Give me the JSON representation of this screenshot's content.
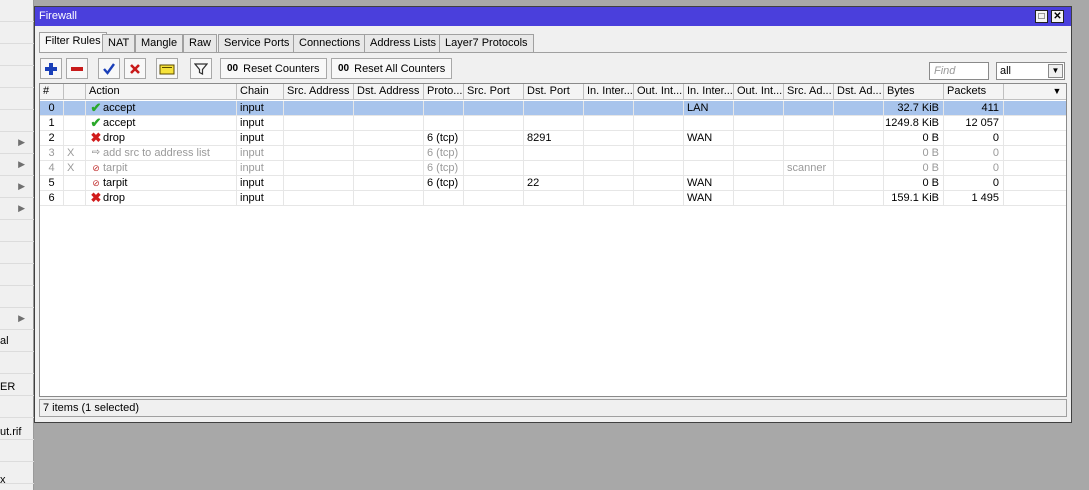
{
  "sidebar": {
    "labels": [
      "al",
      "ER",
      "ut.rif",
      "x"
    ]
  },
  "window": {
    "title": "Firewall",
    "restore_icon": "□",
    "close_icon": "✕"
  },
  "tabs": [
    {
      "label": "Filter Rules",
      "active": true
    },
    {
      "label": "NAT"
    },
    {
      "label": "Mangle"
    },
    {
      "label": "Raw"
    },
    {
      "label": "Service Ports"
    },
    {
      "label": "Connections"
    },
    {
      "label": "Address Lists"
    },
    {
      "label": "Layer7 Protocols"
    }
  ],
  "toolbar": {
    "add_icon": "plus-icon",
    "remove_icon": "minus-icon",
    "enable_icon": "check-icon",
    "disable_icon": "x-icon",
    "comment_icon": "comment-icon",
    "filter_icon": "filter-icon",
    "reset_counters": "Reset Counters",
    "reset_all_counters": "Reset All Counters",
    "counters_glyph": "00",
    "find_placeholder": "Find",
    "filter_select": "all"
  },
  "columns": [
    "#",
    "",
    "Action",
    "Chain",
    "Src. Address",
    "Dst. Address",
    "Proto...",
    "Src. Port",
    "Dst. Port",
    "In. Inter...",
    "Out. Int...",
    "In. Inter...",
    "Out. Int...",
    "Src. Ad...",
    "Dst. Ad...",
    "Bytes",
    "Packets"
  ],
  "rows": [
    {
      "num": "0",
      "flag": "",
      "action": "accept",
      "action_icon": "check",
      "chain": "input",
      "proto": "",
      "dst_port": "",
      "in_list": "LAN",
      "src_addr_list": "",
      "bytes": "32.7 KiB",
      "packets": "411",
      "selected": true,
      "disabled": false
    },
    {
      "num": "1",
      "flag": "",
      "action": "accept",
      "action_icon": "check",
      "chain": "input",
      "proto": "",
      "dst_port": "",
      "in_list": "",
      "src_addr_list": "",
      "bytes": "1249.8 KiB",
      "packets": "12 057",
      "selected": false,
      "disabled": false
    },
    {
      "num": "2",
      "flag": "",
      "action": "drop",
      "action_icon": "x",
      "chain": "input",
      "proto": "6 (tcp)",
      "dst_port": "8291",
      "in_list": "WAN",
      "src_addr_list": "",
      "bytes": "0 B",
      "packets": "0",
      "selected": false,
      "disabled": false
    },
    {
      "num": "3",
      "flag": "X",
      "action": "add src to address list",
      "action_icon": "addr",
      "chain": "input",
      "proto": "6 (tcp)",
      "dst_port": "",
      "in_list": "",
      "src_addr_list": "",
      "bytes": "0 B",
      "packets": "0",
      "selected": false,
      "disabled": true
    },
    {
      "num": "4",
      "flag": "X",
      "action": "tarpit",
      "action_icon": "tarpit",
      "chain": "input",
      "proto": "6 (tcp)",
      "dst_port": "",
      "in_list": "",
      "src_addr_list": "scanner",
      "bytes": "0 B",
      "packets": "0",
      "selected": false,
      "disabled": true
    },
    {
      "num": "5",
      "flag": "",
      "action": "tarpit",
      "action_icon": "tarpit",
      "chain": "input",
      "proto": "6 (tcp)",
      "dst_port": "22",
      "in_list": "WAN",
      "src_addr_list": "",
      "bytes": "0 B",
      "packets": "0",
      "selected": false,
      "disabled": false
    },
    {
      "num": "6",
      "flag": "",
      "action": "drop",
      "action_icon": "x",
      "chain": "input",
      "proto": "",
      "dst_port": "",
      "in_list": "WAN",
      "src_addr_list": "",
      "bytes": "159.1 KiB",
      "packets": "1 495",
      "selected": false,
      "disabled": false
    }
  ],
  "status": "7 items (1 selected)"
}
